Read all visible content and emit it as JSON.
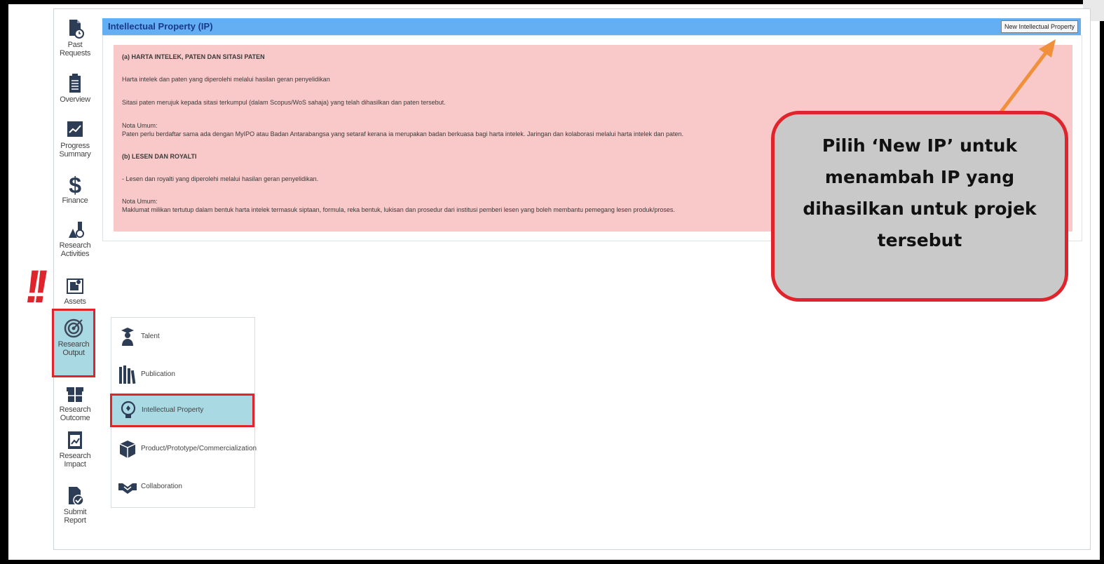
{
  "panel": {
    "title": "Intellectual Property (IP)",
    "new_button": "New Intellectual Property"
  },
  "info": {
    "heading_a": "(a) HARTA INTELEK, PATEN DAN SITASI PATEN",
    "line_1": "Harta intelek dan paten yang diperolehi melalui hasilan geran penyelidikan",
    "line_2": "Sitasi paten merujuk kepada sitasi terkumpul (dalam Scopus/WoS sahaja) yang telah dihasilkan dan paten tersebut.",
    "note_label_1": "Nota Umum:",
    "note_1": "Paten perlu berdaftar sama ada dengan MyIPO atau Badan Antarabangsa yang setaraf kerana ia merupakan badan berkuasa bagi harta intelek. Jaringan dan kolaborasi melalui harta intelek dan paten.",
    "heading_b": "(b) LESEN DAN ROYALTI",
    "line_3": "- Lesen dan royalti yang diperolehi melalui hasilan geran penyelidikan.",
    "note_label_2": "Nota Umum:",
    "note_2": "Maklumat milikan tertutup dalam bentuk harta intelek termasuk siptaan, formula, reka bentuk, lukisan dan prosedur dari institusi pemberi lesen yang boleh membantu pemegang lesen produk/proses."
  },
  "sidebar": {
    "items": [
      {
        "label_1": "Past Requests",
        "label_2": "",
        "icon": "document-clock-icon"
      },
      {
        "label_1": "Overview",
        "label_2": "",
        "icon": "document-list-icon"
      },
      {
        "label_1": "Progress",
        "label_2": "Summary",
        "icon": "chart-icon"
      },
      {
        "label_1": "Finance",
        "label_2": "",
        "icon": "dollar-icon"
      },
      {
        "label_1": "Research",
        "label_2": "Activities",
        "icon": "flask-icon"
      },
      {
        "label_1": "Assets",
        "label_2": "",
        "icon": "puzzle-icon"
      },
      {
        "label_1": "Research",
        "label_2": "Output",
        "icon": "target-icon"
      },
      {
        "label_1": "Research",
        "label_2": "Outcome",
        "icon": "gift-icon"
      },
      {
        "label_1": "Research",
        "label_2": "Impact",
        "icon": "impact-chart-icon"
      },
      {
        "label_1": "Submit Report",
        "label_2": "",
        "icon": "submit-check-icon"
      }
    ]
  },
  "submenu": {
    "items": [
      {
        "label": "Talent",
        "icon": "graduate-icon"
      },
      {
        "label": "Publication",
        "icon": "books-icon"
      },
      {
        "label": "Intellectual Property",
        "icon": "lightbulb-icon"
      },
      {
        "label": "Product/Prototype/Commercialization",
        "icon": "box-icon"
      },
      {
        "label": "Collaboration",
        "icon": "handshake-icon"
      }
    ]
  },
  "callout": {
    "text": "Pilih ‘New IP’ untuk menambah IP yang dihasilkan untuk projek tersebut"
  },
  "alert": "!!",
  "colors": {
    "header_bar": "#64aef4",
    "info_box": "#f9c8c8",
    "highlight": "#e0242c",
    "active_bg": "#a9d9e3",
    "arrow": "#f0903a",
    "callout_bg": "#c9c9c9"
  }
}
